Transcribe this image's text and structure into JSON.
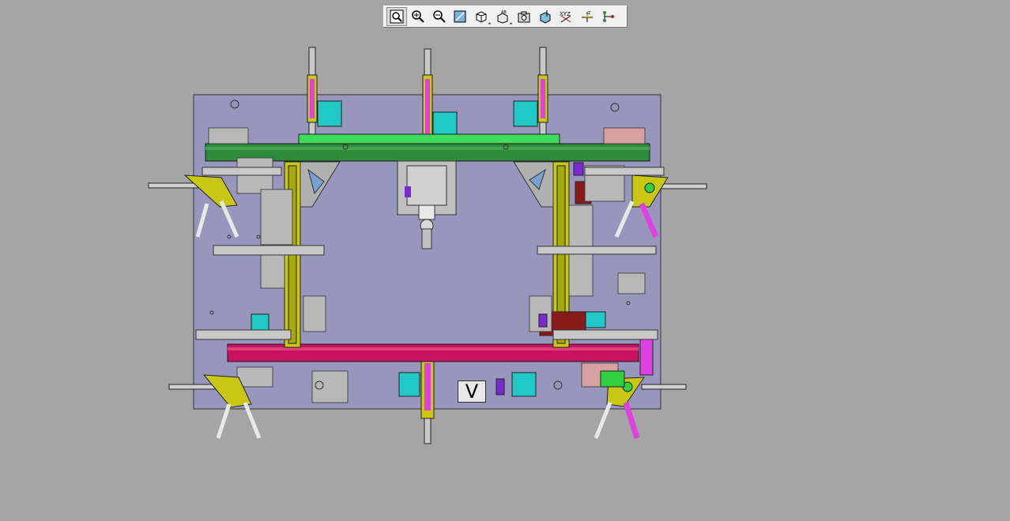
{
  "toolbar": {
    "buttons": [
      {
        "name": "zoom-fit-icon"
      },
      {
        "name": "zoom-in-icon"
      },
      {
        "name": "zoom-out-icon"
      },
      {
        "name": "zoom-area-icon"
      },
      {
        "name": "view-orientation-icon"
      },
      {
        "name": "display-style-icon"
      },
      {
        "name": "snapshot-icon"
      },
      {
        "name": "section-view-icon"
      },
      {
        "name": "hide-show-icon"
      },
      {
        "name": "measure-icon"
      },
      {
        "name": "network-icon"
      }
    ]
  },
  "model": {
    "label": "V"
  },
  "colors": {
    "background": "#a5a5a5",
    "plate": "#9996bd",
    "green_rail": "#2e8b3c",
    "light_green": "#3ddc5a",
    "magenta_rail": "#c8125f",
    "yellow": "#c8c814",
    "cyan": "#20c8c8",
    "pink": "#e040e0"
  }
}
